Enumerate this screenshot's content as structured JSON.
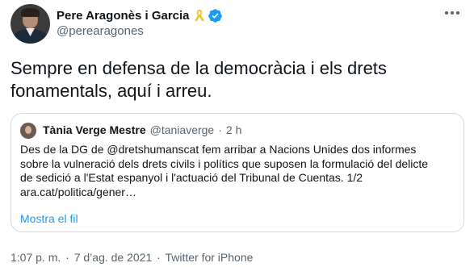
{
  "author": {
    "display_name": "Pere Aragonès i Garcia",
    "handle": "@perearagones"
  },
  "tweet": {
    "text_line_1": "Sempre en defensa de la democràcia i els drets",
    "text_line_2": "fonamentals, aquí i arreu."
  },
  "quoted_tweet": {
    "display_name": "Tània Verge Mestre",
    "handle": "@taniaverge",
    "separator": "·",
    "time": "2 h",
    "lines": [
      "Des de la DG de @dretshumanscat fem arribar a Nacions Unides dos informes",
      "sobre la vulneració dels drets civils i polítics que suposen la formulació del delicte",
      "de sedició a l'Estat espanyol i l'actuació del Tribunal de Cuentas. 1/2",
      "ara.cat/politica/gener…"
    ],
    "show_thread_label": "Mostra el fil"
  },
  "meta": {
    "time": "1:07 p. m.",
    "separator": "·",
    "date": "7 d’ag. de 2021",
    "source": "Twitter for iPhone"
  },
  "colors": {
    "text": "#0f1419",
    "secondary": "#536471",
    "link": "#1d9bf0",
    "verified": "#1d9bf0",
    "ribbon": "#f2c230",
    "border": "#cfd9de"
  },
  "icons": {
    "ribbon": "yellow-ribbon-icon",
    "verified": "verified-badge-icon",
    "more": "more-options-icon"
  }
}
